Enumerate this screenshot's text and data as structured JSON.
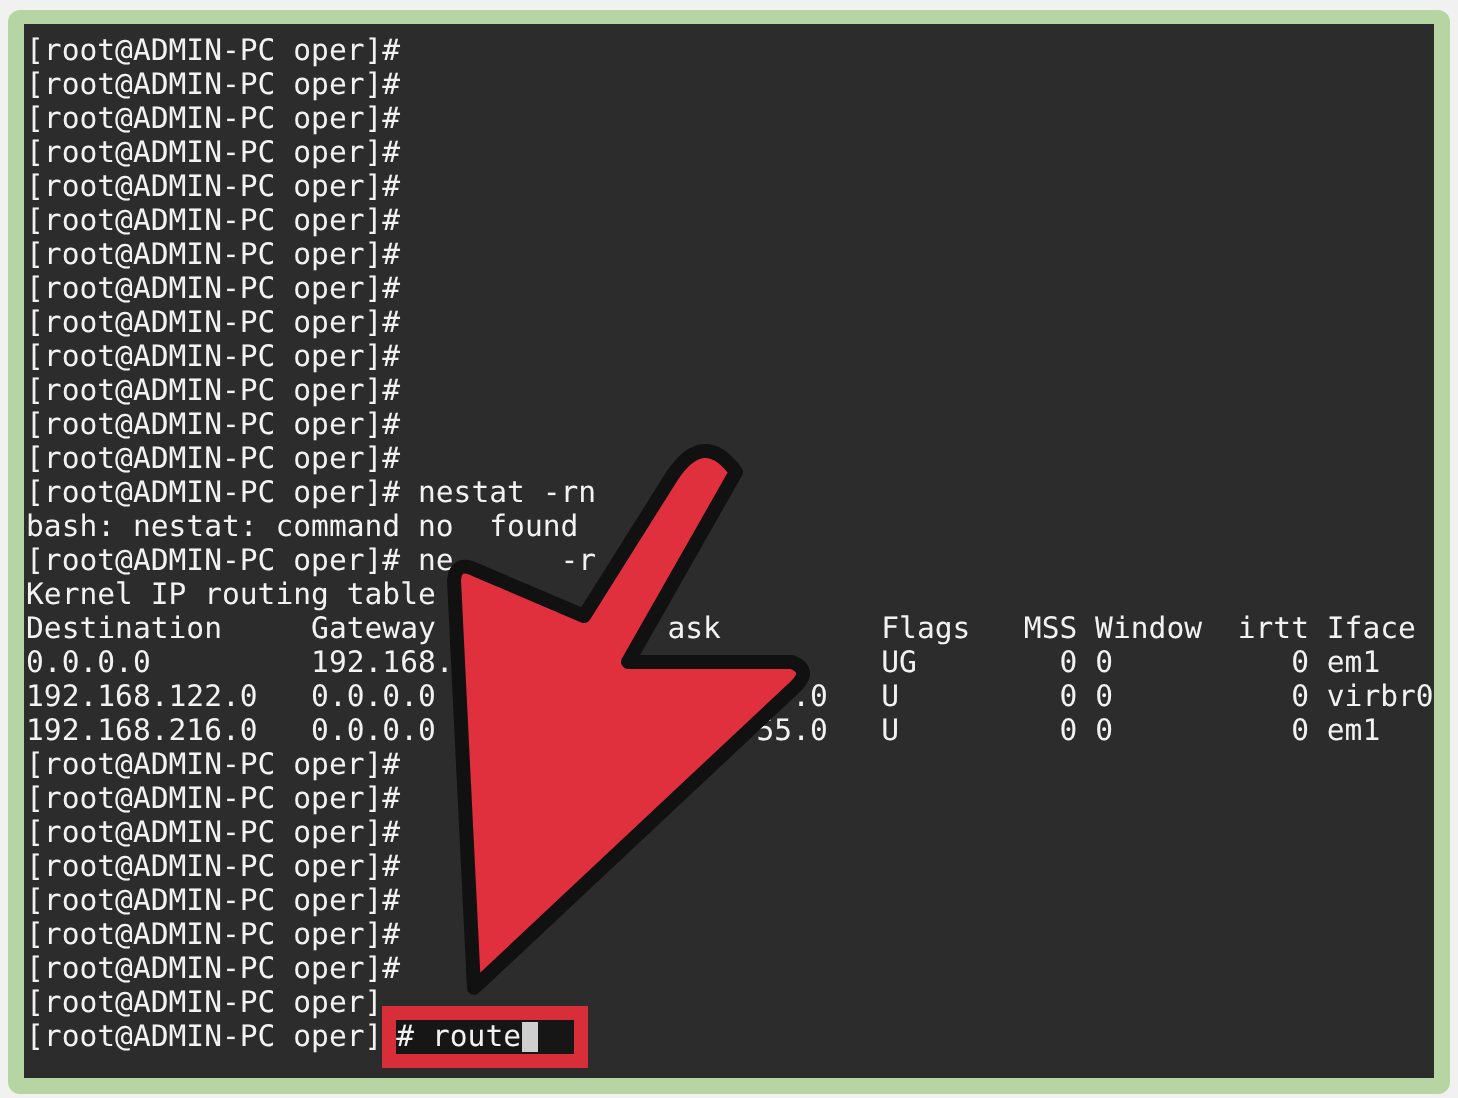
{
  "terminal": {
    "lines": [
      "[root@ADMIN-PC oper]#",
      "[root@ADMIN-PC oper]#",
      "[root@ADMIN-PC oper]#",
      "[root@ADMIN-PC oper]#",
      "[root@ADMIN-PC oper]#",
      "[root@ADMIN-PC oper]#",
      "[root@ADMIN-PC oper]#",
      "[root@ADMIN-PC oper]#",
      "[root@ADMIN-PC oper]#",
      "[root@ADMIN-PC oper]#",
      "[root@ADMIN-PC oper]#",
      "[root@ADMIN-PC oper]#",
      "[root@ADMIN-PC oper]#",
      "[root@ADMIN-PC oper]# nestat -rn",
      "bash: nestat: command no  found",
      "[root@ADMIN-PC oper]# ne      -r",
      "Kernel IP routing table",
      "Destination     Gateway             ask         Flags   MSS Window  irtt Iface",
      "0.0.0.0         192.168.                        UG        0 0          0 em1",
      "192.168.122.0   0.0.0.0                    .0   U         0 0          0 virbr0",
      "192.168.216.0   0.0.0.0                  55.0   U         0 0          0 em1",
      "[root@ADMIN-PC oper]#",
      "[root@ADMIN-PC oper]#",
      "[root@ADMIN-PC oper]#",
      "[root@ADMIN-PC oper]#",
      "[root@ADMIN-PC oper]#",
      "[root@ADMIN-PC oper]#",
      "[root@ADMIN-PC oper]#",
      "[root@ADMIN-PC oper]"
    ],
    "input_line": {
      "prompt": "[root@ADMIN-PC oper]",
      "command": "# route",
      "cursor": true
    }
  }
}
